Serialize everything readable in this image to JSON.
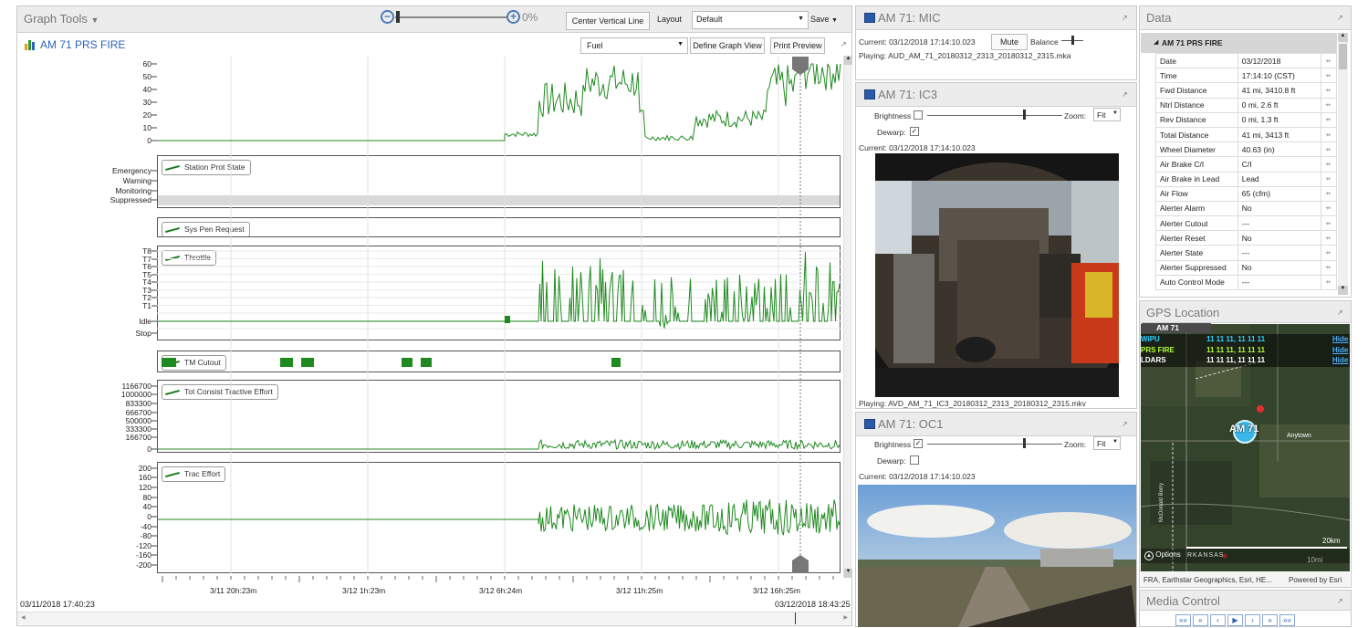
{
  "toolbar": {
    "graph_tools_label": "Graph Tools",
    "zoom_value": "0%",
    "center_vertical_line_label": "Center Vertical Line",
    "layout_label": "Layout",
    "layout_value": "Default",
    "save_label": "Save"
  },
  "graph": {
    "title": "AM 71 PRS FIRE",
    "channel_select": "Fuel",
    "define_graph_view_label": "Define Graph View",
    "print_preview_label": "Print Preview",
    "start_time": "03/11/2018 17:40:23",
    "end_time": "03/12/2018 18:43:25",
    "x_ticks": [
      "3/11 20h:23m",
      "3/12 1h:23m",
      "3/12 6h:24m",
      "3/12 11h:25m",
      "3/12 16h:25m"
    ],
    "fuel_ticks": [
      "60",
      "50",
      "40",
      "30",
      "20",
      "10",
      "0"
    ],
    "station_prot_ticks": [
      "Emergency",
      "Warning",
      "Monitoring",
      "Suppressed"
    ],
    "throttle_ticks": [
      "T8",
      "T7",
      "T6",
      "T5",
      "T4",
      "T3",
      "T2",
      "T1",
      "Idle",
      "Stop"
    ],
    "tractive_ticks": [
      "1166700",
      "1000000",
      "833300",
      "666700",
      "500000",
      "333300",
      "166700",
      "0"
    ],
    "trac_effort_ticks": [
      "200",
      "160",
      "120",
      "80",
      "40",
      "0",
      "-40",
      "-80",
      "-120",
      "-160",
      "-200"
    ],
    "strips": {
      "station_prot": "Station Prot State",
      "sys_pen": "Sys Pen Request",
      "throttle": "Throttle",
      "tm_cutout": "TM Cutout",
      "tot_tractive": "Tot Consist Tractive Effort",
      "trac_effort": "Trac Effort"
    },
    "line_color": "#1f8a1f"
  },
  "mic": {
    "title": "AM 71: MIC",
    "current": "Current: 03/12/2018 17:14:10.023",
    "mute_label": "Mute",
    "balance_label": "Balance",
    "playing": "Playing: AUD_AM_71_20180312_2313_20180312_2315.mka"
  },
  "ic3": {
    "title": "AM 71: IC3",
    "brightness_label": "Brightness",
    "zoom_label": "Zoom:",
    "zoom_value": "Fit",
    "dewarp_label": "Dewarp:",
    "current": "Current: 03/12/2018 17:14:10.023",
    "playing": "Playing: AVD_AM_71_IC3_20180312_2313_20180312_2315.mkv"
  },
  "oc1": {
    "title": "AM 71: OC1",
    "brightness_label": "Brightness",
    "zoom_label": "Zoom:",
    "zoom_value": "Fit",
    "dewarp_label": "Dewarp:",
    "current": "Current: 03/12/2018 17:14:10.023"
  },
  "data_panel": {
    "title": "Data",
    "group": "AM 71 PRS FIRE",
    "rows": [
      {
        "k": "Date",
        "v": "03/12/2018"
      },
      {
        "k": "Time",
        "v": "17:14:10 (CST)"
      },
      {
        "k": "Fwd Distance",
        "v": "41 mi, 3410.8 ft"
      },
      {
        "k": "Ntrl Distance",
        "v": "0 mi, 2.6 ft"
      },
      {
        "k": "Rev Distance",
        "v": "0 mi, 1.3 ft"
      },
      {
        "k": "Total Distance",
        "v": "41 mi, 3413 ft"
      },
      {
        "k": "Wheel Diameter",
        "v": "40.63 (in)"
      },
      {
        "k": "Air Brake C/I",
        "v": "C/I"
      },
      {
        "k": "Air Brake in Lead",
        "v": "Lead"
      },
      {
        "k": "Air Flow",
        "v": "65 (cfm)"
      },
      {
        "k": "Alerter Alarm",
        "v": "No"
      },
      {
        "k": "Alerter Cutout",
        "v": "---"
      },
      {
        "k": "Alerter Reset",
        "v": "No"
      },
      {
        "k": "Alerter State",
        "v": "---"
      },
      {
        "k": "Alerter Suppressed",
        "v": "No"
      },
      {
        "k": "Auto Control Mode",
        "v": "---"
      }
    ]
  },
  "gps": {
    "title": "GPS Location",
    "header": "AM 71",
    "rows": [
      {
        "name": "WiPU",
        "coords": "11 11 11, 11 11 11",
        "hide": "Hide",
        "color": "#2fd1ff"
      },
      {
        "name": "PRS FIRE",
        "coords": "11 11 11, 11 11 11",
        "hide": "Hide",
        "color": "#b4ff3a"
      },
      {
        "name": "LDARS",
        "coords": "11 11 11, 11 11 11",
        "hide": "Hide",
        "color": "#ffffff"
      }
    ],
    "marker": "AM 71",
    "town": "Anytown",
    "road": "McDonald Berry",
    "scale_km": "20km",
    "scale_mi": "10mi",
    "options_label": "Options",
    "state_label": "RKANSAS",
    "attribution": "FRA, Earthstar Geographics, Esri, HE...",
    "powered": "Powered by Esri"
  },
  "media": {
    "title": "Media Control"
  }
}
